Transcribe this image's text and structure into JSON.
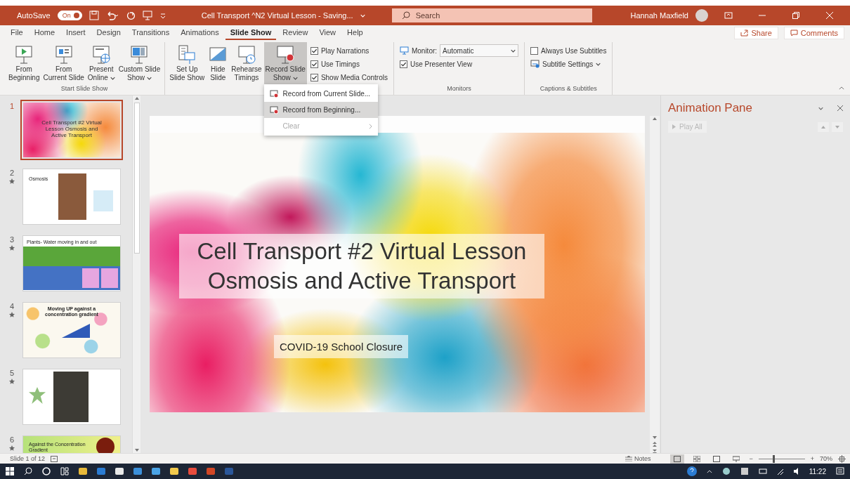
{
  "title_bar": {
    "autosave_label": "AutoSave",
    "autosave_state": "On",
    "autosave_on": true,
    "document_title": "Cell Transport ^N2 Virtual Lesson  -  Saving...",
    "search_placeholder": "Search",
    "user_name": "Hannah Maxfield"
  },
  "menu_tabs": [
    {
      "label": "File",
      "selected": false
    },
    {
      "label": "Home",
      "selected": false
    },
    {
      "label": "Insert",
      "selected": false
    },
    {
      "label": "Design",
      "selected": false
    },
    {
      "label": "Transitions",
      "selected": false
    },
    {
      "label": "Animations",
      "selected": false
    },
    {
      "label": "Slide Show",
      "selected": true
    },
    {
      "label": "Review",
      "selected": false
    },
    {
      "label": "View",
      "selected": false
    },
    {
      "label": "Help",
      "selected": false
    }
  ],
  "share_button": "Share",
  "comments_button": "Comments",
  "ribbon_groups": [
    {
      "label": "Start Slide Show",
      "items": [
        {
          "kind": "large",
          "lines": [
            "From",
            "Beginning"
          ],
          "dropdown": false,
          "pressed": false
        },
        {
          "kind": "large",
          "lines": [
            "From",
            "Current Slide"
          ],
          "dropdown": false,
          "pressed": false
        },
        {
          "kind": "large",
          "lines": [
            "Present",
            "Online"
          ],
          "dropdown": true,
          "pressed": false
        },
        {
          "kind": "large",
          "lines": [
            "Custom Slide",
            "Show"
          ],
          "dropdown": true,
          "pressed": false
        }
      ]
    },
    {
      "items": [
        {
          "kind": "large",
          "lines": [
            "Set Up",
            "Slide Show"
          ],
          "dropdown": false,
          "pressed": false
        },
        {
          "kind": "large",
          "lines": [
            "Hide",
            "Slide"
          ],
          "dropdown": false,
          "pressed": false
        },
        {
          "kind": "large",
          "lines": [
            "Rehearse",
            "Timings"
          ],
          "dropdown": false,
          "pressed": false
        },
        {
          "kind": "large",
          "lines": [
            "Record Slide",
            "Show"
          ],
          "dropdown": true,
          "pressed": true,
          "menu": [
            {
              "label": "Record from Current Slide...",
              "highlighted": false,
              "disabled": false,
              "submenu": false
            },
            {
              "label": "Record from Beginning...",
              "highlighted": true,
              "disabled": false,
              "submenu": false
            },
            {
              "label": "Clear",
              "highlighted": false,
              "disabled": true,
              "submenu": true
            }
          ]
        },
        {
          "kind": "stack",
          "items": [
            {
              "kind": "checkbox",
              "label": "Play Narrations",
              "checked": true
            },
            {
              "kind": "checkbox",
              "label": "Use Timings",
              "checked": true
            },
            {
              "kind": "checkbox",
              "label": "Show Media Controls",
              "checked": true
            }
          ]
        }
      ]
    },
    {
      "label": "Monitors",
      "items": [
        {
          "kind": "stack",
          "items": [
            {
              "kind": "select",
              "label": "Monitor:",
              "value": "Automatic"
            },
            {
              "kind": "checkbox",
              "label": "Use Presenter View",
              "checked": true
            }
          ]
        }
      ]
    },
    {
      "label": "Captions & Subtitles",
      "items": [
        {
          "kind": "stack",
          "items": [
            {
              "kind": "checkbox",
              "label": "Always Use Subtitles",
              "checked": false
            },
            {
              "kind": "menu_button",
              "label": "Subtitle Settings"
            }
          ]
        }
      ]
    }
  ],
  "thumbnails": [
    {
      "number": "1",
      "selected": true,
      "has_animation": false,
      "kind": "ink",
      "title": "Cell Transport #2 Virtual Lesson Osmosis and Active Transport"
    },
    {
      "number": "2",
      "selected": false,
      "has_animation": true,
      "kind": "text_photo",
      "title": "Osmosis"
    },
    {
      "number": "3",
      "selected": false,
      "has_animation": true,
      "kind": "bands",
      "title": "Plants- Water moving in and out"
    },
    {
      "number": "4",
      "selected": false,
      "has_animation": true,
      "kind": "pattern",
      "title": "Moving UP against a concentration gradient"
    },
    {
      "number": "5",
      "selected": false,
      "has_animation": true,
      "kind": "photo"
    },
    {
      "number": "6",
      "selected": false,
      "has_animation": true,
      "kind": "gradient",
      "title": "Against the Concentration Gradient"
    }
  ],
  "slide": {
    "title_lines": [
      "Cell Transport #2 Virtual Lesson",
      "Osmosis and Active Transport"
    ],
    "subtitle": "COVID-19 School Closure"
  },
  "animation_pane": {
    "title": "Animation Pane",
    "play_all": "Play All",
    "play_all_disabled": true
  },
  "status_bar": {
    "slide_count": "Slide 1 of 12",
    "notes": "Notes",
    "views": [
      {
        "selected": true
      },
      {
        "selected": false
      },
      {
        "selected": false
      },
      {
        "selected": false
      }
    ],
    "zoom_minus": "−",
    "zoom_plus": "+",
    "zoom_slider": {
      "level": 0.3
    },
    "zoom": "70%"
  },
  "taskbar": {
    "time": "11:22"
  }
}
